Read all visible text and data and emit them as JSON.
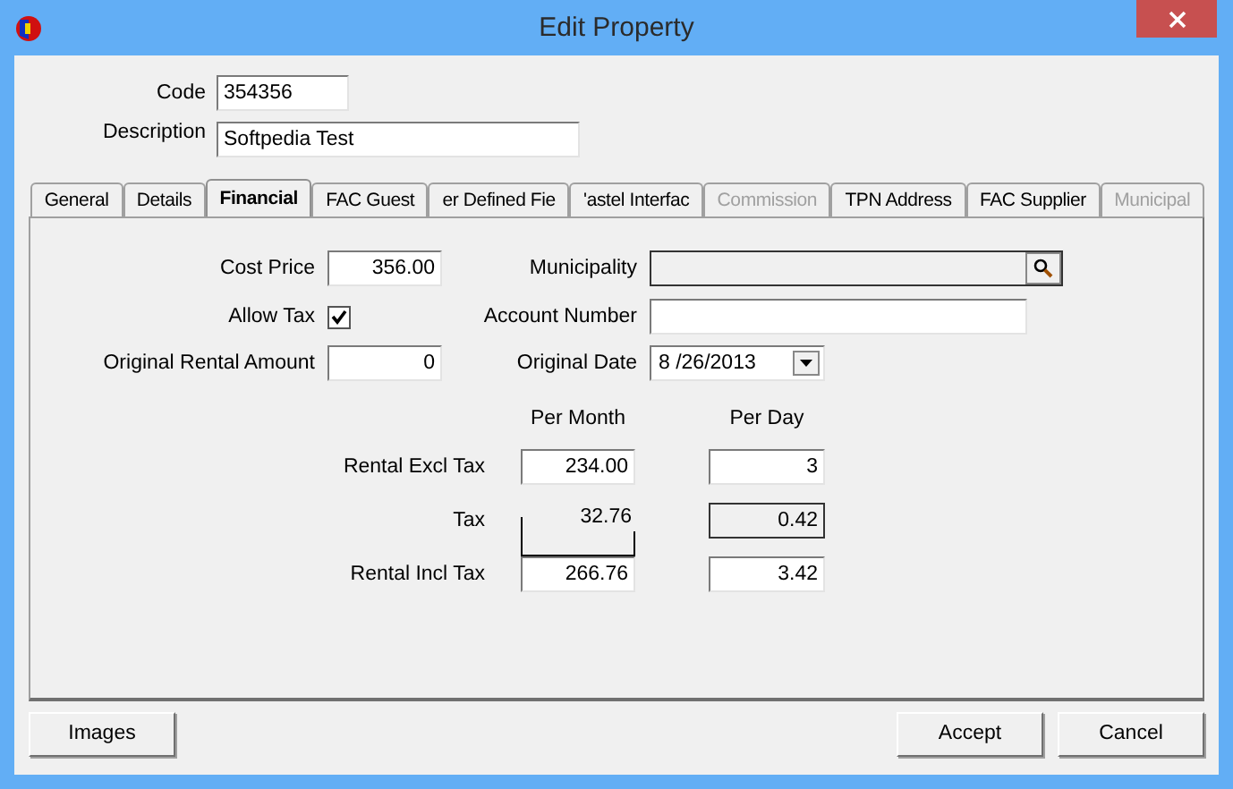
{
  "window": {
    "title": "Edit Property"
  },
  "code": {
    "label": "Code",
    "value": "354356"
  },
  "description": {
    "label": "Description",
    "value": "Softpedia Test"
  },
  "tabs": [
    {
      "label": "General",
      "selected": false,
      "disabled": false
    },
    {
      "label": "Details",
      "selected": false,
      "disabled": false
    },
    {
      "label": "Financial",
      "selected": true,
      "disabled": false
    },
    {
      "label": "FAC Guest",
      "selected": false,
      "disabled": false
    },
    {
      "label": "er Defined Fie",
      "selected": false,
      "disabled": false
    },
    {
      "label": "'astel Interfac",
      "selected": false,
      "disabled": false
    },
    {
      "label": "Commission",
      "selected": false,
      "disabled": true
    },
    {
      "label": "TPN Address",
      "selected": false,
      "disabled": false
    },
    {
      "label": "FAC Supplier",
      "selected": false,
      "disabled": false
    },
    {
      "label": "Municipal",
      "selected": false,
      "disabled": true
    }
  ],
  "financial": {
    "cost_price": {
      "label": "Cost Price",
      "value": "356.00"
    },
    "allow_tax": {
      "label": "Allow Tax",
      "checked": true
    },
    "original_rental_amount": {
      "label": "Original Rental Amount",
      "value": "0"
    },
    "municipality": {
      "label": "Municipality"
    },
    "account_number": {
      "label": "Account Number"
    },
    "original_date": {
      "label": "Original Date",
      "value": "8 /26/2013"
    },
    "columns": [
      "Per Month",
      "Per Day"
    ],
    "rows": [
      {
        "kind": "input",
        "label": "Rental Excl Tax",
        "per_month": "234.00",
        "per_day": "3"
      },
      {
        "kind": "computed",
        "label": "Tax",
        "per_month": "32.76",
        "per_day": "0.42"
      },
      {
        "kind": "input",
        "label": "Rental Incl Tax",
        "per_month": "266.76",
        "per_day": "3.42"
      }
    ]
  },
  "buttons": [
    {
      "label": "Images",
      "kind": "left"
    },
    {
      "label": "Accept",
      "kind": "right"
    },
    {
      "label": "Cancel",
      "kind": "right"
    }
  ]
}
